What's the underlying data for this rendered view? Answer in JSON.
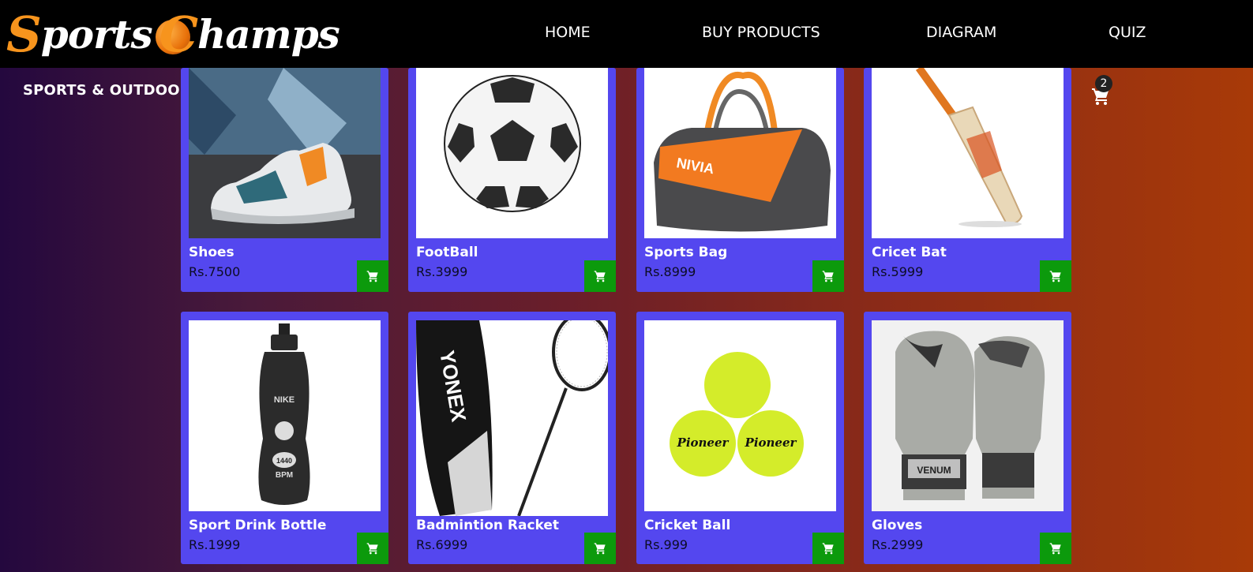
{
  "brand": {
    "first_big": "S",
    "first_rest": "ports ",
    "second_big": "C",
    "second_rest": "hamps"
  },
  "nav": {
    "home": "HOME",
    "buy_products": "BUY PRODUCTS",
    "diagram": "DIAGRAM",
    "quiz": "QUIZ"
  },
  "category": "SPORTS & OUTDOOR",
  "cart": {
    "count": "2",
    "icon": "cart-icon"
  },
  "colors": {
    "card": "#5447ef",
    "add_button": "#0c9a0c",
    "nav": "#000000",
    "logo_accent": "#f7941d"
  },
  "products": [
    {
      "name": "Shoes",
      "price": "Rs.7500"
    },
    {
      "name": "FootBall",
      "price": "Rs.3999"
    },
    {
      "name": "Sports Bag",
      "price": "Rs.8999"
    },
    {
      "name": "Cricet Bat",
      "price": "Rs.5999"
    },
    {
      "name": "Sport Drink Bottle",
      "price": "Rs.1999"
    },
    {
      "name": "Badmintion Racket",
      "price": "Rs.6999"
    },
    {
      "name": "Cricket Ball",
      "price": "Rs.999"
    },
    {
      "name": "Gloves",
      "price": "Rs.2999"
    }
  ],
  "image_text": {
    "bag_brand": "NIVIA",
    "bottle_brand": "NIKE",
    "bottle_number": "1440",
    "bottle_unit": "BPM",
    "racket_brand": "YONEX",
    "ball_brand_left": "Pioneer",
    "ball_brand_right": "Pioneer",
    "glove_brand": "VENUM"
  }
}
